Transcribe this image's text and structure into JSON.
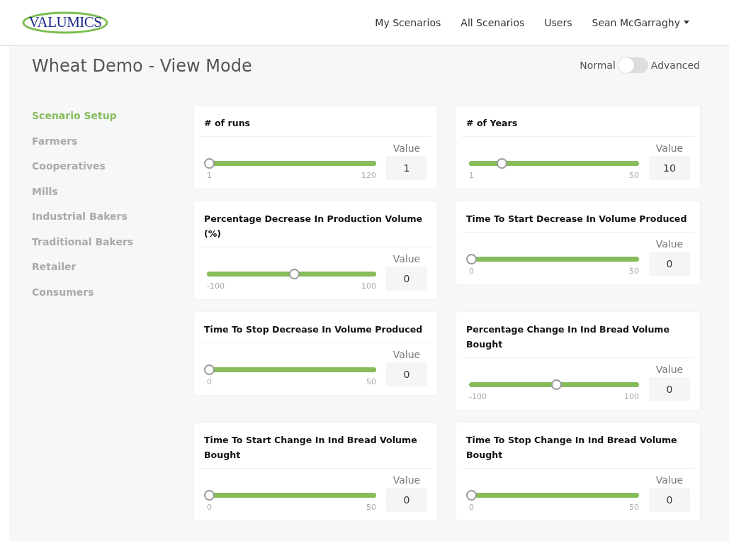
{
  "logo": {
    "text": "VALUMICS"
  },
  "nav": [
    {
      "label": "My Scenarios",
      "kind": "link"
    },
    {
      "label": "All Scenarios",
      "kind": "link"
    },
    {
      "label": "Users",
      "kind": "link"
    },
    {
      "label": "Sean McGarraghy",
      "kind": "dropdown"
    }
  ],
  "page_title": "Wheat Demo - View Mode",
  "mode_toggle": {
    "left_label": "Normal",
    "right_label": "Advanced",
    "on": false
  },
  "sidebar": {
    "items": [
      {
        "label": "Scenario Setup",
        "selected": true
      },
      {
        "label": "Farmers",
        "selected": false
      },
      {
        "label": "Cooperatives",
        "selected": false
      },
      {
        "label": "Mills",
        "selected": false
      },
      {
        "label": "Industrial Bakers",
        "selected": false
      },
      {
        "label": "Traditional Bakers",
        "selected": false
      },
      {
        "label": "Retailer",
        "selected": false
      },
      {
        "label": "Consumers",
        "selected": false
      }
    ]
  },
  "parameters": [
    {
      "title": "# of runs",
      "min": "1",
      "max": "120",
      "level": 0,
      "value_label": "Value",
      "value": "1"
    },
    {
      "title": "# of Years",
      "min": "1",
      "max": "50",
      "level": 0.18,
      "value_label": "Value",
      "value": "10"
    },
    {
      "title": "Percentage Decrease In Production Volume (%)",
      "min": "-100",
      "max": "100",
      "level": 0.5,
      "value_label": "Value",
      "value": "0"
    },
    {
      "title": "Time To Start Decrease In Volume Produced",
      "min": "0",
      "max": "50",
      "level": 0,
      "value_label": "Value",
      "value": "0"
    },
    {
      "title": "Time To Stop Decrease In Volume Produced",
      "min": "0",
      "max": "50",
      "level": 0,
      "value_label": "Value",
      "value": "0"
    },
    {
      "title": "Percentage Change In Ind Bread Volume Bought",
      "min": "-100",
      "max": "100",
      "level": 0.5,
      "value_label": "Value",
      "value": "0"
    },
    {
      "title": "Time To Start Change In Ind Bread Volume Bought",
      "min": "0",
      "max": "50",
      "level": 0,
      "value_label": "Value",
      "value": "0"
    },
    {
      "title": "Time To Stop Change In Ind Bread Volume Bought",
      "min": "0",
      "max": "50",
      "level": 0,
      "value_label": "Value",
      "value": "0"
    }
  ]
}
